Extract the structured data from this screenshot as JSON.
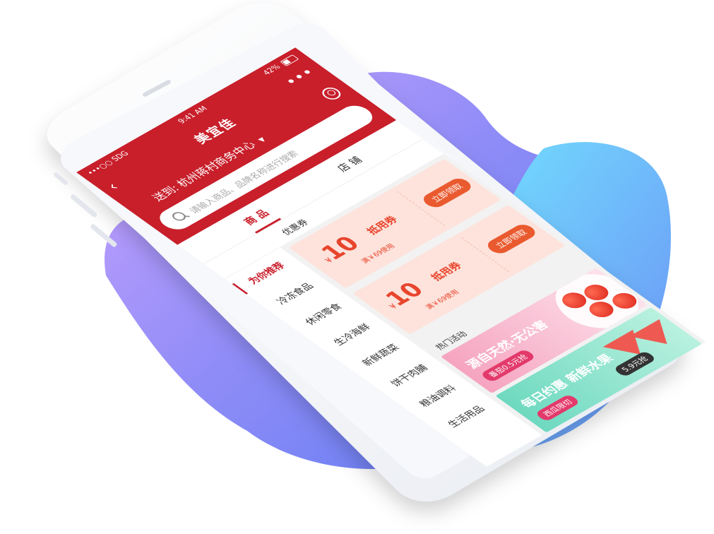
{
  "status_bar": {
    "carrier": "•••○○ SDG",
    "time": "9:41 AM",
    "battery": "42%"
  },
  "nav": {
    "back": "‹",
    "title": "美宜佳",
    "more": "•••"
  },
  "location": {
    "prefix": "送到:",
    "place": "杭州蒋村商务中心",
    "arrow": "▼"
  },
  "search": {
    "placeholder": "请输入商品、品牌名称进行搜索"
  },
  "tabs": [
    {
      "label": "商 品",
      "active": true
    },
    {
      "label": "店 铺",
      "active": false
    }
  ],
  "subtabs": [
    {
      "label": "优惠券"
    }
  ],
  "categories": [
    {
      "label": "为你推荐",
      "active": true
    },
    {
      "label": "冷冻食品",
      "active": false
    },
    {
      "label": "休闲零食",
      "active": false
    },
    {
      "label": "生冷海鲜",
      "active": false
    },
    {
      "label": "新鲜蔬菜",
      "active": false
    },
    {
      "label": "饼干肉脯",
      "active": false
    },
    {
      "label": "粮油调料",
      "active": false
    },
    {
      "label": "生活用品",
      "active": false
    }
  ],
  "coupons": [
    {
      "yen": "¥",
      "amount": "10",
      "name": "抵用券",
      "condition": "满￥69使用",
      "button": "立即领取"
    },
    {
      "yen": "¥",
      "amount": "10",
      "name": "抵用券",
      "condition": "满￥69使用",
      "button": "立即领取"
    }
  ],
  "section_title": "热门活动",
  "banners": [
    {
      "headline": "源自天然·无公害",
      "price": "番茄0.5元抢"
    },
    {
      "headline": "每日约惠 新鲜水果",
      "tag": "西瓜限切",
      "price": "5.9元抢"
    }
  ],
  "colors": {
    "brand_red": "#c81f2b",
    "coupon_bg": "#fde3dc",
    "coupon_text": "#e8452d",
    "button_orange": "#ea5a2f",
    "blob_purple": "#b58cf6",
    "blob_blue": "#6fa8f5"
  }
}
